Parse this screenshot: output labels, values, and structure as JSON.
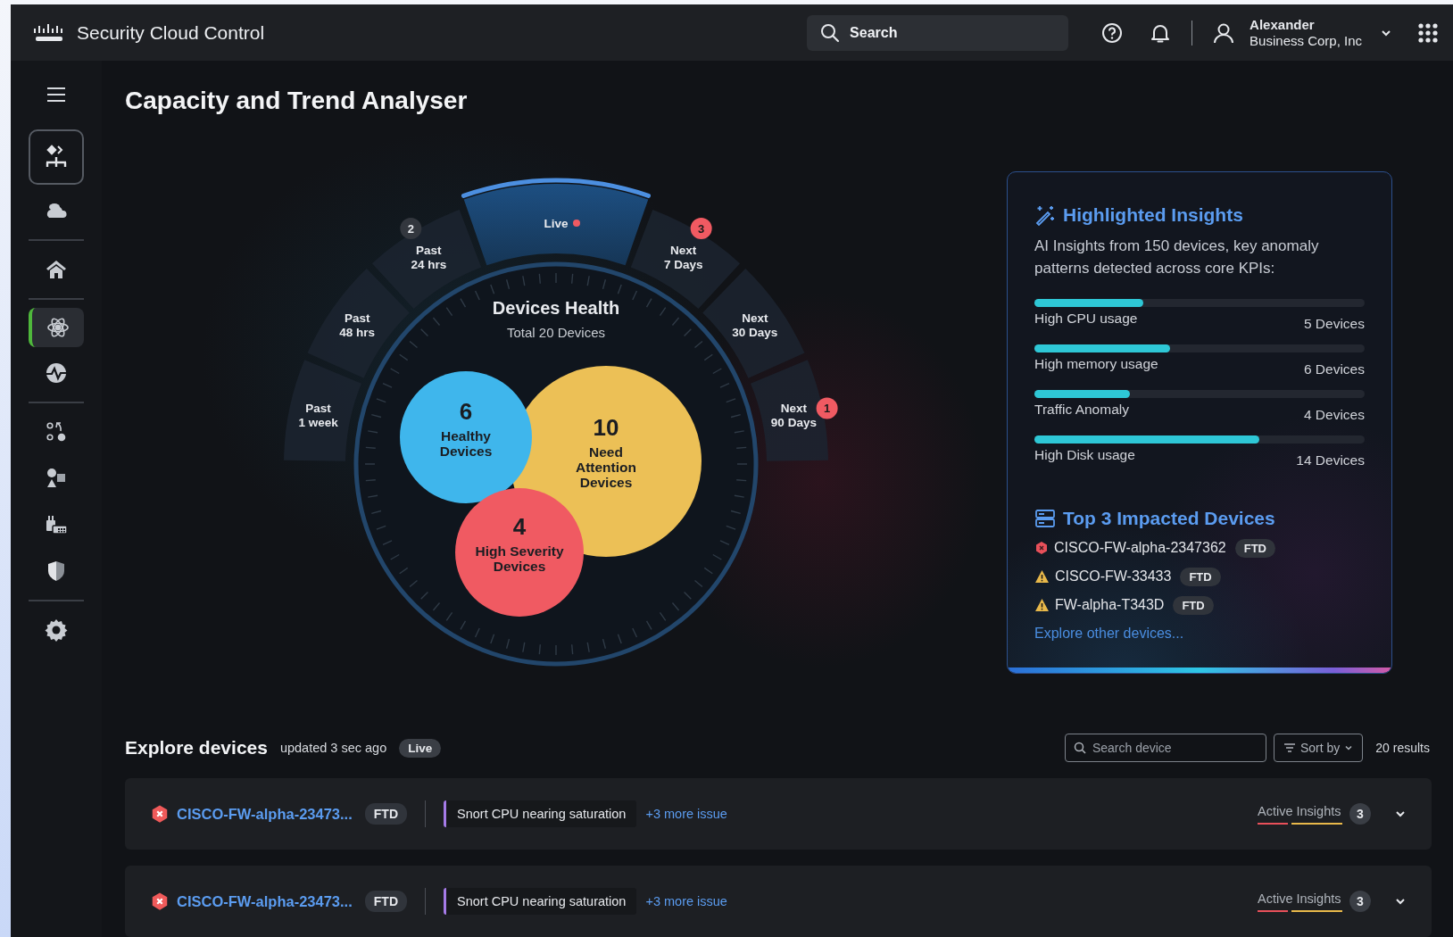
{
  "header": {
    "brand": "Security Cloud Control",
    "search": {
      "placeholder": "Search"
    },
    "user": {
      "name": "Alexander",
      "org": "Business Corp, Inc"
    }
  },
  "sidebar": {
    "groups": [
      [
        {
          "kind": "launcher",
          "selected": false
        },
        {
          "kind": "nav",
          "selected": false
        }
      ],
      [
        {
          "kind": "nav",
          "selected": false
        }
      ],
      [
        {
          "kind": "nav",
          "selected": true
        },
        {
          "kind": "nav",
          "selected": false
        }
      ],
      [
        {
          "kind": "nav",
          "selected": false
        },
        {
          "kind": "nav",
          "selected": false
        },
        {
          "kind": "nav",
          "selected": false
        },
        {
          "kind": "nav",
          "selected": false
        }
      ],
      [
        {
          "kind": "nav",
          "selected": false
        }
      ]
    ]
  },
  "page": {
    "title": "Capacity and Trend Analyser"
  },
  "health": {
    "title": "Devices Health",
    "subtitle": "Total 20 Devices",
    "time_ranges": [
      {
        "lines": [
          "Past",
          "1 week"
        ],
        "selected": false,
        "live": false
      },
      {
        "lines": [
          "Past",
          "48 hrs"
        ],
        "selected": false,
        "live": false
      },
      {
        "lines": [
          "Past",
          "24 hrs"
        ],
        "selected": false,
        "live": false,
        "badge": {
          "count": "2",
          "alert": false
        }
      },
      {
        "lines": [
          "Live"
        ],
        "selected": true,
        "live": true
      },
      {
        "lines": [
          "Next",
          "7 Days"
        ],
        "selected": false,
        "live": false,
        "badge": {
          "count": "3",
          "alert": true
        }
      },
      {
        "lines": [
          "Next",
          "30 Days"
        ],
        "selected": false,
        "live": false
      },
      {
        "lines": [
          "Next",
          "90 Days"
        ],
        "selected": false,
        "live": false,
        "badge": {
          "count": "1",
          "alert": true
        }
      }
    ],
    "groups": [
      {
        "count": "10",
        "lines": [
          "Need",
          "Attention",
          "Devices"
        ],
        "color": "#ecc056"
      },
      {
        "count": "6",
        "lines": [
          "Healthy",
          "Devices"
        ],
        "color": "#3fb6ec"
      },
      {
        "count": "4",
        "lines": [
          "High Severity",
          "Devices"
        ],
        "color": "#f05a62"
      }
    ]
  },
  "insights": {
    "title": "Highlighted Insights",
    "description": "AI Insights from 150 devices, key anomaly patterns detected across core KPIs:",
    "metrics": [
      {
        "label": "High CPU usage",
        "value": "5 Devices",
        "level": 0.33
      },
      {
        "label": "High memory usage",
        "value": "6 Devices",
        "level": 0.41
      },
      {
        "label": "Traffic Anomaly",
        "value": "4 Devices",
        "level": 0.29
      },
      {
        "label": "High Disk usage",
        "value": "14 Devices",
        "level": 0.68
      }
    ],
    "top_title": "Top 3 Impacted Devices",
    "top_devices": [
      {
        "name": "CISCO-FW-alpha-2347362",
        "tag": "FTD",
        "critical": true
      },
      {
        "name": "CISCO-FW-33433",
        "tag": "FTD",
        "critical": false
      },
      {
        "name": "FW-alpha-T343D",
        "tag": "FTD",
        "critical": false
      }
    ],
    "link": "Explore other devices..."
  },
  "explore": {
    "title": "Explore devices",
    "updated": "updated 3 sec ago",
    "live": "Live",
    "search": {
      "placeholder": "Search device"
    },
    "sort": "Sort by",
    "results": "20 results",
    "rows": [
      {
        "name": "CISCO-FW-alpha-23473...",
        "tag": "FTD",
        "critical": true,
        "issue": "Snort CPU nearing saturation",
        "more": "+3 more issue",
        "insights_label": "Active Insights",
        "insights_count": "3"
      },
      {
        "name": "CISCO-FW-alpha-23473...",
        "tag": "FTD",
        "critical": true,
        "issue": "Snort CPU nearing saturation",
        "more": "+3 more issue",
        "insights_label": "Active Insights",
        "insights_count": "3"
      }
    ]
  }
}
